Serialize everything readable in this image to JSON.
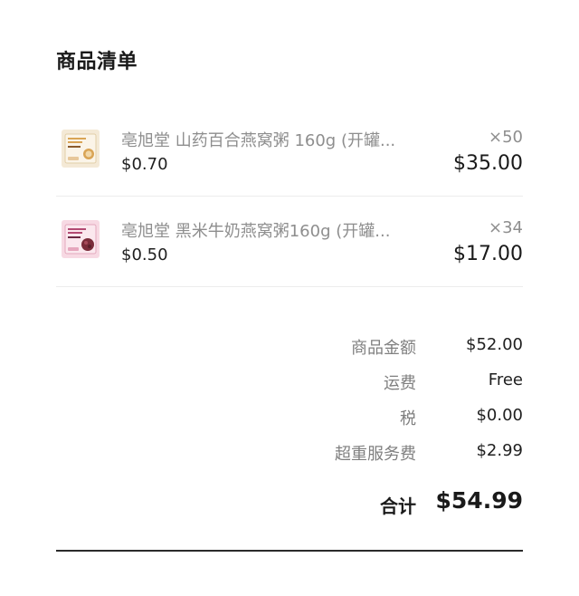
{
  "section_title": "商品清单",
  "items": [
    {
      "name": "亳旭堂 山药百合燕窝粥 160g (开罐...",
      "unit_price": "$0.70",
      "quantity": "×50",
      "line_total": "$35.00",
      "thumbnail_text": "山药百合燕窝粥",
      "thumbnail_colors": {
        "background": "#f4e9d6",
        "accent": "#d9a455",
        "label": "#8b5a2b"
      }
    },
    {
      "name": "亳旭堂 黑米牛奶燕窝粥160g (开罐...",
      "unit_price": "$0.50",
      "quantity": "×34",
      "line_total": "$17.00",
      "thumbnail_text": "黑米牛奶燕窝粥",
      "thumbnail_colors": {
        "background": "#f7d9e3",
        "accent": "#b34a73",
        "label": "#6b2a44"
      }
    }
  ],
  "summary": {
    "subtotal": {
      "label": "商品金额",
      "value": "$52.00"
    },
    "shipping": {
      "label": "运费",
      "value": "Free"
    },
    "tax": {
      "label": "税",
      "value": "$0.00"
    },
    "overweight_fee": {
      "label": "超重服务费",
      "value": "$2.99"
    }
  },
  "total": {
    "label": "合计",
    "value": "$54.99"
  }
}
